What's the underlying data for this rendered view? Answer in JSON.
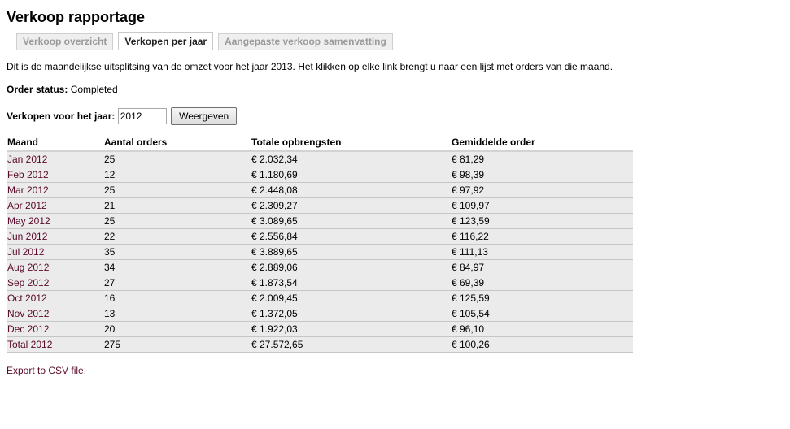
{
  "page": {
    "title": "Verkoop rapportage"
  },
  "tabs": [
    {
      "label": "Verkoop overzicht",
      "active": false
    },
    {
      "label": "Verkopen per jaar",
      "active": true
    },
    {
      "label": "Aangepaste verkoop samenvatting",
      "active": false
    }
  ],
  "description": "Dit is de maandelijkse uitsplitsing van de omzet voor het jaar 2013. Het klikken op elke link brengt u naar een lijst met orders van die maand.",
  "order_status": {
    "label": "Order status:",
    "value": "Completed"
  },
  "year_form": {
    "label": "Verkopen voor het jaar:",
    "value": "2012",
    "button_label": "Weergeven"
  },
  "table": {
    "headers": [
      "Maand",
      "Aantal orders",
      "Totale opbrengsten",
      "Gemiddelde order"
    ],
    "rows": [
      [
        "Jan 2012",
        "25",
        "€ 2.032,34",
        "€ 81,29"
      ],
      [
        "Feb 2012",
        "12",
        "€ 1.180,69",
        "€ 98,39"
      ],
      [
        "Mar 2012",
        "25",
        "€ 2.448,08",
        "€ 97,92"
      ],
      [
        "Apr 2012",
        "21",
        "€ 2.309,27",
        "€ 109,97"
      ],
      [
        "May 2012",
        "25",
        "€ 3.089,65",
        "€ 123,59"
      ],
      [
        "Jun 2012",
        "22",
        "€ 2.556,84",
        "€ 116,22"
      ],
      [
        "Jul 2012",
        "35",
        "€ 3.889,65",
        "€ 111,13"
      ],
      [
        "Aug 2012",
        "34",
        "€ 2.889,06",
        "€ 84,97"
      ],
      [
        "Sep 2012",
        "27",
        "€ 1.873,54",
        "€ 69,39"
      ],
      [
        "Oct 2012",
        "16",
        "€ 2.009,45",
        "€ 125,59"
      ],
      [
        "Nov 2012",
        "13",
        "€ 1.372,05",
        "€ 105,54"
      ],
      [
        "Dec 2012",
        "20",
        "€ 1.922,03",
        "€ 96,10"
      ],
      [
        "Total 2012",
        "275",
        "€ 27.572,65",
        "€ 100,26"
      ]
    ]
  },
  "export_link": "Export to CSV file.",
  "colors": {
    "link": "#5a0a2a",
    "row_background": "#ebebeb",
    "inactive_tab_text": "#9a9a9a"
  }
}
